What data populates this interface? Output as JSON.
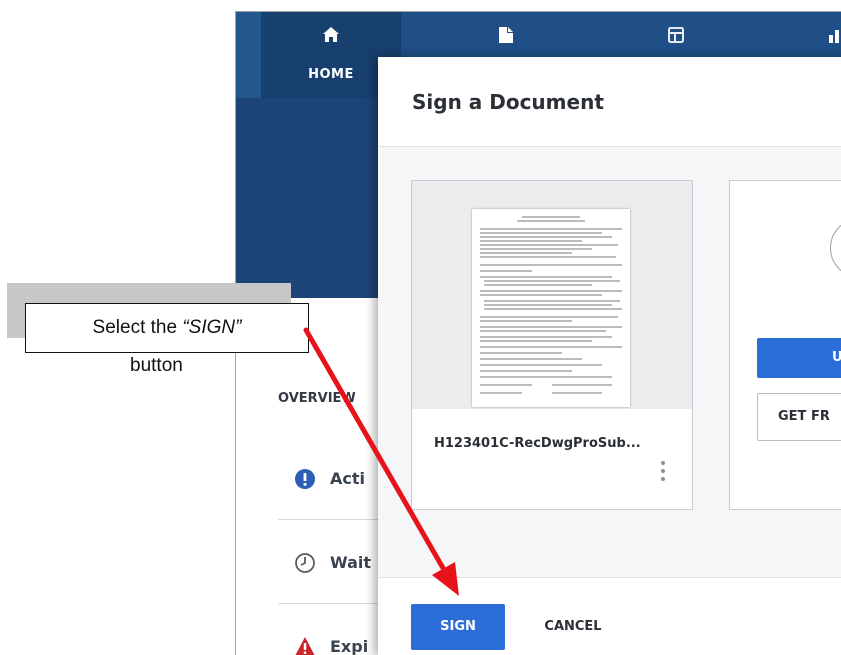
{
  "nav": {
    "home_label": "HOME",
    "items": [
      {
        "name": "home",
        "icon": "home-icon"
      },
      {
        "name": "documents",
        "icon": "document-icon"
      },
      {
        "name": "templates",
        "icon": "template-icon"
      },
      {
        "name": "reports",
        "icon": "bar-chart-icon"
      }
    ]
  },
  "background": {
    "overview_label": "OVERVIEW",
    "items": [
      {
        "label": "Acti",
        "icon": "exclamation-icon",
        "color": "#2c5fb3"
      },
      {
        "label": "Wait",
        "icon": "clock-icon",
        "color": "#555b63"
      },
      {
        "label": "Expi",
        "icon": "warning-icon",
        "color": "#c8262c"
      }
    ]
  },
  "modal": {
    "title": "Sign a Document",
    "document": {
      "name": "H123401C-RecDwgProSub..."
    },
    "upload_label": "U",
    "get_from_label": "GET FR",
    "sign_label": "SIGN",
    "cancel_label": "CANCEL"
  },
  "callout": {
    "prefix": "Select the ",
    "emphasis": "“SIGN”",
    "line2": "button"
  },
  "colors": {
    "nav_bg": "#1f4f86",
    "primary": "#2c6ed8",
    "arrow": "#e8131a"
  }
}
